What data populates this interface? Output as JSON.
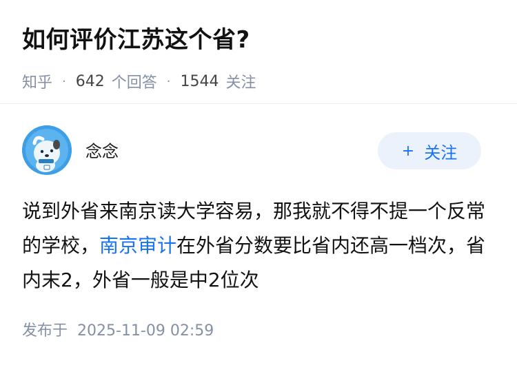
{
  "question": {
    "title": "如何评价江苏这个省?",
    "site": "知乎",
    "answer_count": "642",
    "answer_label": "个回答",
    "follower_count": "1544",
    "follower_label": "关注"
  },
  "author": {
    "name": "念念",
    "follow_label": "关注",
    "follow_icon": "plus-icon"
  },
  "answer": {
    "text_before": "说到外省来南京读大学容易，那我就不得不提一个反常的学校，",
    "link_text": "南京审计",
    "text_after": "在外省分数要比省内还高一档次，省内末2，外省一般是中2位次"
  },
  "published": {
    "label": "发布于",
    "time": "2025-11-09 02:59"
  },
  "colors": {
    "accent": "#1772f6",
    "meta_gray": "#8590a6",
    "avatar_bg": "#3f9fe6",
    "follow_bg": "#ebf2fc"
  }
}
